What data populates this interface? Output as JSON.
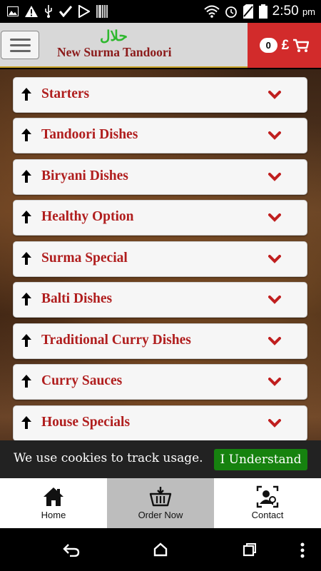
{
  "status_bar": {
    "time": "2:50",
    "ampm": "pm"
  },
  "header": {
    "logo_halal": "حلال",
    "logo_name": "New Surma Tandoori",
    "cart_count": "0",
    "cart_currency": "£"
  },
  "categories": [
    {
      "label": "Starters"
    },
    {
      "label": "Tandoori Dishes"
    },
    {
      "label": "Biryani Dishes"
    },
    {
      "label": "Healthy Option"
    },
    {
      "label": "Surma Special"
    },
    {
      "label": "Balti Dishes"
    },
    {
      "label": "Traditional Curry Dishes"
    },
    {
      "label": "Curry Sauces"
    },
    {
      "label": "House Specials"
    }
  ],
  "cookie": {
    "text": "We use cookies to track usage.",
    "button": "I Understand"
  },
  "bottom_nav": [
    {
      "label": "Home",
      "icon": "home-icon"
    },
    {
      "label": "Order Now",
      "icon": "basket-icon"
    },
    {
      "label": "Contact",
      "icon": "contact-icon"
    }
  ],
  "colors": {
    "accent_red": "#d22b2b",
    "category_text": "#b01e1e",
    "cookie_button": "#16820f",
    "logo_green": "#2db82d"
  }
}
